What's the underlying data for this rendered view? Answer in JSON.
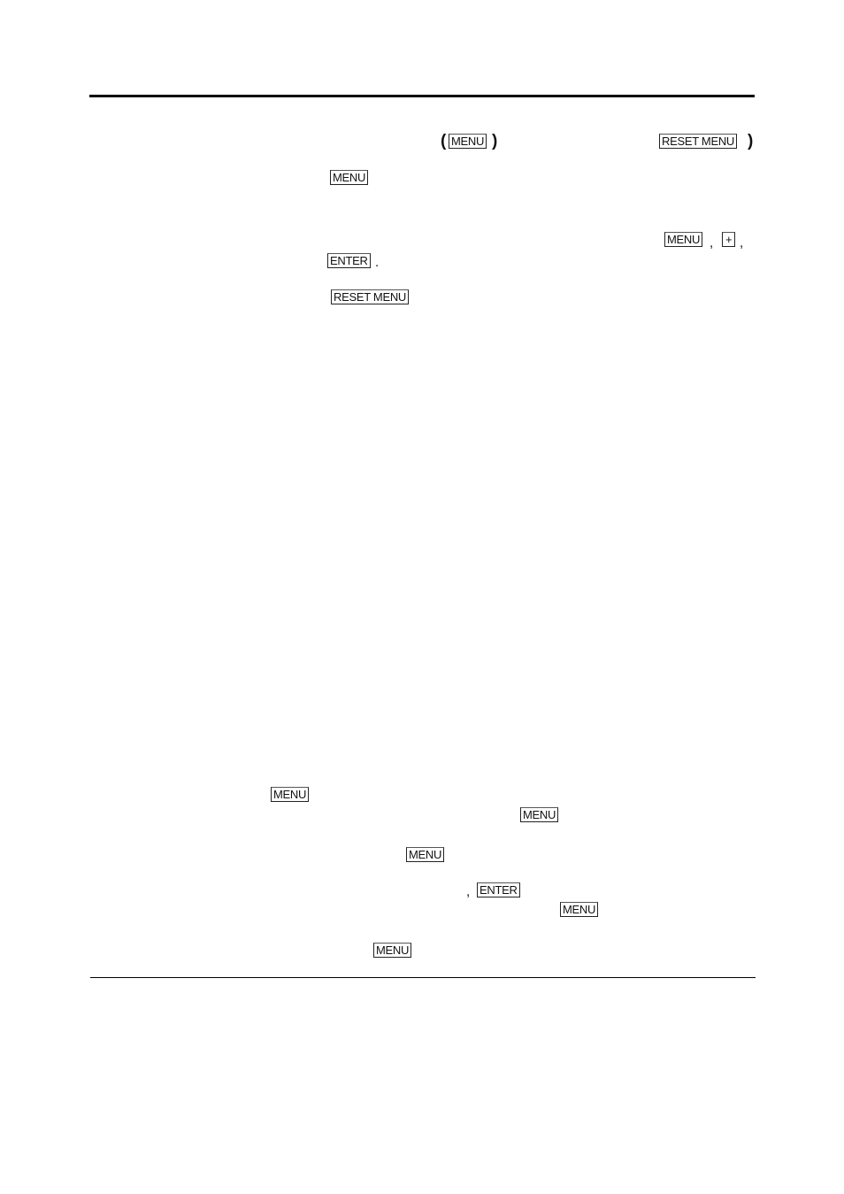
{
  "keys": {
    "menu": "MENU",
    "reset_menu": "RESET MENU",
    "enter": "ENTER",
    "plus": "+"
  },
  "punctuation": {
    "open_paren": "(",
    "close_paren": ")",
    "comma": ",",
    "period": "."
  }
}
